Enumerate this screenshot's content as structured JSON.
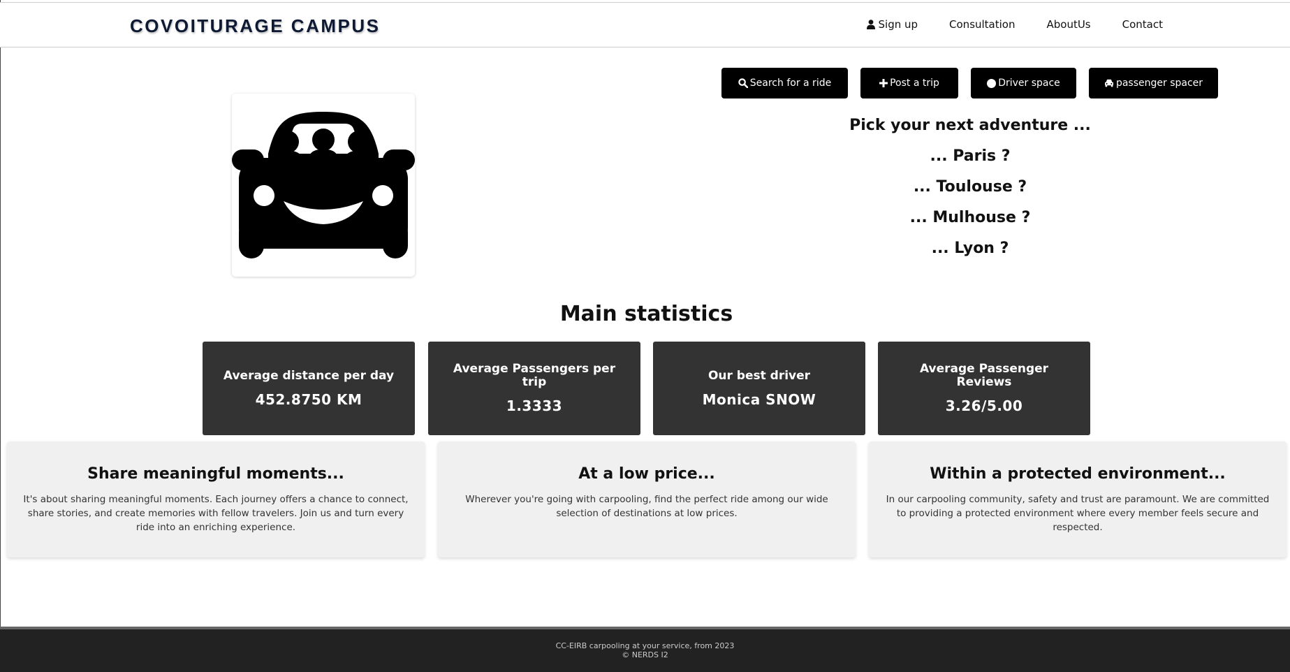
{
  "brand": "COVOITURAGE CAMPUS",
  "nav": {
    "signup": "Sign up",
    "consultation": "Consultation",
    "about": "AboutUs",
    "contact": "Contact"
  },
  "actions": {
    "search": "Search for a ride",
    "post": "Post a trip",
    "driver": "Driver space",
    "passenger": "passenger spacer"
  },
  "adventure": {
    "heading": "Pick your next adventure ...",
    "destinations": [
      "... Paris ?",
      "... Toulouse ?",
      "... Mulhouse ?",
      "... Lyon ?"
    ]
  },
  "stats": {
    "title": "Main statistics",
    "cards": [
      {
        "label": "Average distance per day",
        "value": "452.8750 KM"
      },
      {
        "label": "Average Passengers per trip",
        "value": "1.3333"
      },
      {
        "label": "Our best driver",
        "value": "Monica SNOW"
      },
      {
        "label": "Average Passenger Reviews",
        "value": "3.26/5.00"
      }
    ]
  },
  "features": [
    {
      "title": "Share meaningful moments...",
      "text": "It's about sharing meaningful moments. Each journey offers a chance to connect, share stories, and create memories with fellow travelers. Join us and turn every ride into an enriching experience."
    },
    {
      "title": "At a low price...",
      "text": "Wherever you're going with carpooling, find the perfect ride among our wide selection of destinations at low prices."
    },
    {
      "title": "Within a protected environment...",
      "text": "In our carpooling community, safety and trust are paramount. We are committed to providing a protected environment where every member feels secure and respected."
    }
  ],
  "footer": {
    "line1": "CC-EIRB carpooling at your service, from 2023",
    "line2": "© NERDS I2"
  },
  "icons": {
    "signup": "user-icon",
    "search": "search-icon",
    "post": "plus-icon",
    "driver": "circle-icon",
    "passenger": "car-icon",
    "logo": "carpool-logo"
  },
  "colors": {
    "dark_card": "#333333",
    "button_bg": "#000000",
    "feature_bg": "#f0f0f0",
    "footer_bg": "#222222",
    "brand_text": "#0e1a33"
  }
}
